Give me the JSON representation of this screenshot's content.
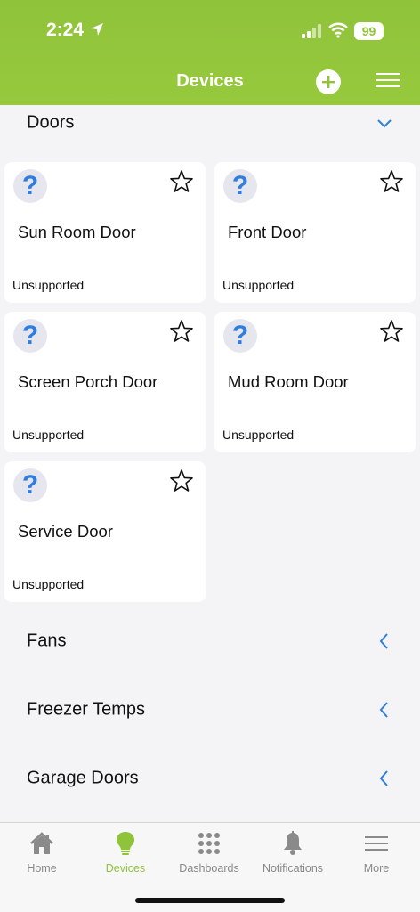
{
  "status_bar": {
    "time": "2:24",
    "battery": "99"
  },
  "header": {
    "title": "Devices"
  },
  "sections": {
    "doors": {
      "title": "Doors"
    },
    "fans": {
      "title": "Fans"
    },
    "freezer": {
      "title": "Freezer Temps"
    },
    "garage": {
      "title": "Garage Doors"
    }
  },
  "cards": [
    {
      "name": "Sun Room Door",
      "status": "Unsupported",
      "icon": "question-icon"
    },
    {
      "name": "Front Door",
      "status": "Unsupported",
      "icon": "question-icon"
    },
    {
      "name": "Screen Porch Door",
      "status": "Unsupported",
      "icon": "question-icon"
    },
    {
      "name": "Mud Room Door",
      "status": "Unsupported",
      "icon": "question-icon"
    },
    {
      "name": "Service Door",
      "status": "Unsupported",
      "icon": "question-icon"
    }
  ],
  "card_icon_glyph": "?",
  "tabs": [
    {
      "label": "Home",
      "icon": "home-icon"
    },
    {
      "label": "Devices",
      "icon": "bulb-icon"
    },
    {
      "label": "Dashboards",
      "icon": "grid-icon"
    },
    {
      "label": "Notifications",
      "icon": "bell-icon"
    },
    {
      "label": "More",
      "icon": "menu-icon"
    }
  ],
  "colors": {
    "accent": "#8fc33a",
    "link": "#2f7de0",
    "background": "#f4f4f6"
  }
}
